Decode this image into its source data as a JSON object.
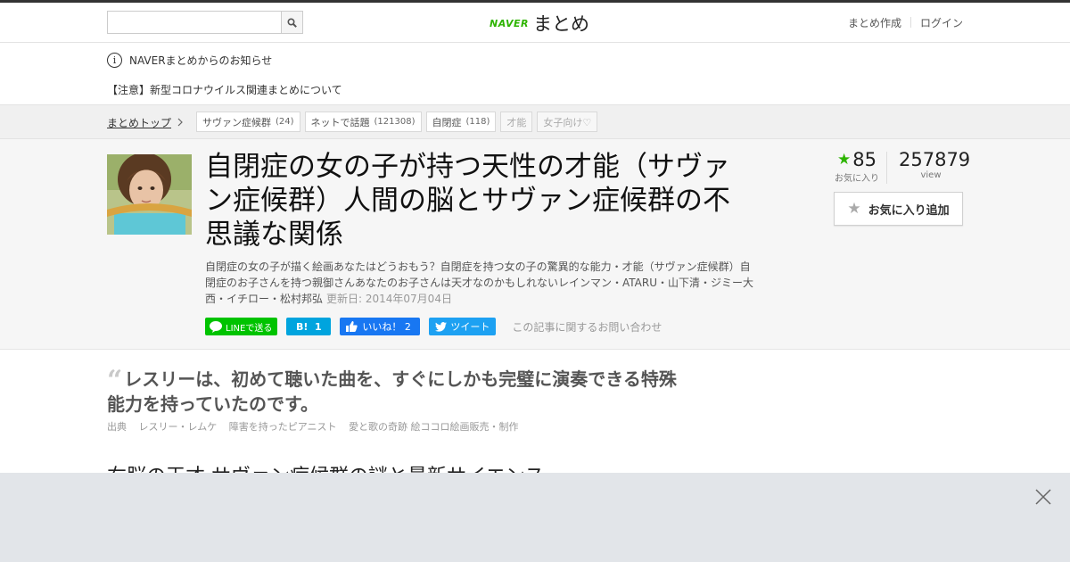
{
  "header": {
    "search_placeholder": "",
    "logo_brand": "NAVER",
    "logo_text": "まとめ",
    "create_label": "まとめ作成",
    "login_label": "ログイン"
  },
  "notice": {
    "title": "NAVERまとめからのお知らせ",
    "item": "【注意】新型コロナウイルス関連まとめについて"
  },
  "breadcrumb": {
    "top_label": "まとめトップ"
  },
  "tags": [
    {
      "label": "サヴァン症候群",
      "count": "(24)"
    },
    {
      "label": "ネットで話題",
      "count": "(121308)"
    },
    {
      "label": "自閉症",
      "count": "(118)"
    },
    {
      "label": "才能",
      "count": ""
    },
    {
      "label": "女子向け♡",
      "count": ""
    }
  ],
  "article": {
    "title": "自閉症の女の子が持つ天性の才能（サヴァン症候群）人間の脳とサヴァン症候群の不思議な関係",
    "description": "自閉症の女の子が描く絵画あなたはどうおもう？自閉症を持つ女の子の驚異的な能力・才能（サヴァン症候群）自閉症のお子さんを持つ親御さんあなたのお子さんは天才なのかもしれないレインマン・ATARU・山下清・ジミー大西・イチロー・松村邦弘",
    "updated": "更新日: 2014年07月04日",
    "fav_count": "85",
    "fav_label": "お気に入り",
    "view_count": "257879",
    "view_label": "view",
    "fav_button": "お気に入り追加"
  },
  "share": {
    "line_label": "LINEで送る",
    "hatena_label": "B!",
    "hatena_count": "1",
    "fb_label": "いいね！",
    "fb_count": "2",
    "tw_label": "ツイート",
    "contact_label": "この記事に関するお問い合わせ"
  },
  "content": {
    "quote": "レスリーは、初めて聴いた曲を、すぐにしかも完璧に演奏できる特殊能力を持っていたのです。",
    "source_prefix": "出典",
    "source_items": [
      "レスリー・レムケ",
      "障害を持ったピアニスト",
      "愛と歌の奇跡 絵ココロ絵画販売・制作"
    ],
    "heading": "右脳の天才 サヴァン症候群の謎と最新サイエンス"
  },
  "colors": {
    "brand_green": "#2db400",
    "line_green": "#00c300",
    "hatena_blue": "#00a4de",
    "facebook_blue": "#1877f2",
    "twitter_blue": "#1da1f2",
    "ad_background": "#e2e5e9"
  }
}
